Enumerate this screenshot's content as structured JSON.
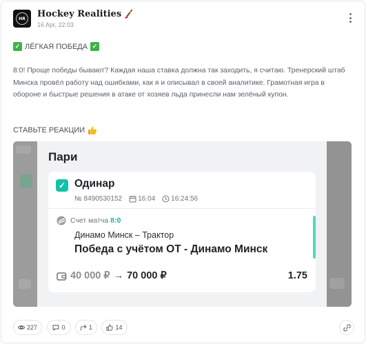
{
  "post": {
    "channel_name": "Hockey Realities",
    "avatar_initials": "HR",
    "date": "16 Apr, 22:03",
    "heading": "ЛЁГКАЯ ПОБЕДА",
    "body": "8:0! Проще победы бывают? Каждая наша ставка должна так заходить, я считаю. Тренерский штаб Минска провёл работу над ошибками, как я и описывал в своей аналитике. Грамотная игра в обороне и быстрые решения в атаке от хозяев льда принесли нам зелёный купон.",
    "reactions_call": "СТАВЬТЕ РЕАКЦИИ"
  },
  "bet": {
    "screen_title": "Пари",
    "type": "Одинар",
    "number": "№ 8490530152",
    "date": "16.04",
    "time": "16:24:56",
    "score_label": "Счет матча",
    "score": "8:0",
    "teams": "Динамо Минск – Трактор",
    "outcome": "Победа с учётом ОТ - Динамо Минск",
    "stake": "40 000 ₽",
    "arrow": "→",
    "payout": "70 000 ₽",
    "coefficient": "1.75"
  },
  "footer": {
    "views": "227",
    "comments": "0",
    "shares": "1",
    "likes": "14"
  },
  "colors": {
    "accent_teal": "#12c2a8",
    "check_green": "#3db24a"
  }
}
